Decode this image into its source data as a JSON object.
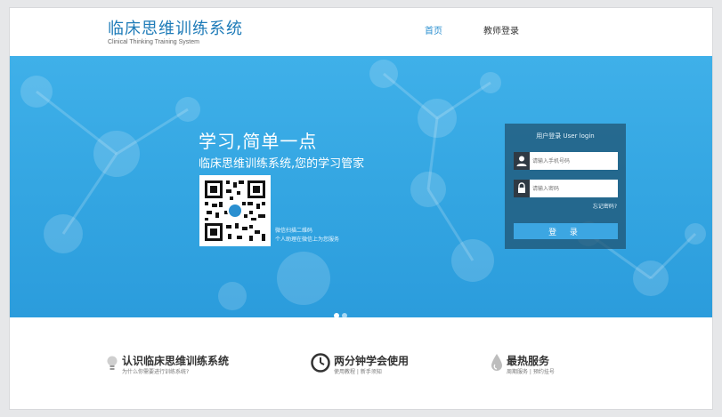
{
  "header": {
    "logo_title": "临床思维训练系统",
    "logo_subtitle": "Clinical Thinking Training System",
    "nav": [
      {
        "label": "首页",
        "active": true
      },
      {
        "label": "教师登录",
        "active": false
      }
    ]
  },
  "banner": {
    "slogan": "学习,简单一点",
    "slogan_sub": "临床思维训练系统,您的学习管家",
    "qr_note_line1": "微信扫描二维码",
    "qr_note_line2": "个人助理在微信上为您服务",
    "background_color": "#36a9e4"
  },
  "login": {
    "title": "用户登录 User login",
    "phone_placeholder": "请输入手机号码",
    "password_placeholder": "请输入密码",
    "forgot_label": "忘记密码?",
    "submit_label": "登 录"
  },
  "carousel": {
    "slides": 2,
    "active": 1
  },
  "features": [
    {
      "title": "认识临床思维训练系统",
      "subtitle": "为什么你需要进行训练系统?",
      "icon": "lightbulb-icon"
    },
    {
      "title": "两分钟学会使用",
      "subtitle": "使用教程 | 新手须知",
      "icon": "clock-icon"
    },
    {
      "title": "最热服务",
      "subtitle": "周期服务 | 预约挂号",
      "icon": "drop-icon"
    }
  ]
}
